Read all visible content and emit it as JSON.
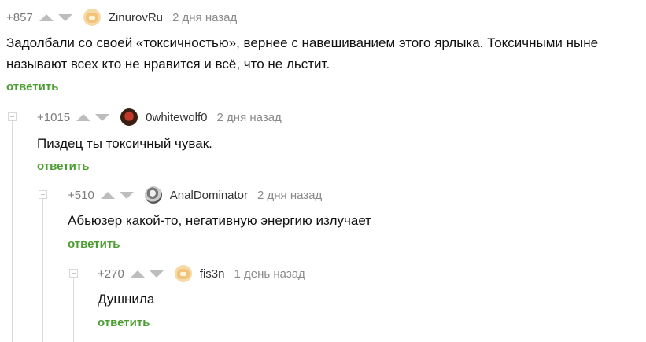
{
  "comments": [
    {
      "rating": "+857",
      "author": "ZinurovRu",
      "time": "2 дня назад",
      "text_lines": [
        "Задолбали со своей «токсичностью», вернее с навешиванием этого ярлыка. Токсичными ныне",
        "называют всех кто не нравится и всё, что не льстит."
      ],
      "reply_label": "ответить",
      "avatar": "default-avatar-icon"
    },
    {
      "rating": "+1015",
      "author": "0whitewolf0",
      "time": "2 дня назад",
      "text_lines": [
        "Пиздец ты токсичный чувак."
      ],
      "reply_label": "ответить",
      "avatar": "wolf-avatar-icon"
    },
    {
      "rating": "+510",
      "author": "AnalDominator",
      "time": "2 дня назад",
      "text_lines": [
        "Абьюзер какой-то, негативную энергию излучает"
      ],
      "reply_label": "ответить",
      "avatar": "sketch-avatar-icon"
    },
    {
      "rating": "+270",
      "author": "fis3n",
      "time": "1 день назад",
      "text_lines": [
        "Душнила"
      ],
      "reply_label": "ответить",
      "avatar": "default-avatar-icon"
    }
  ],
  "colors": {
    "reply": "#4a9d2f",
    "rating": "#7b7b7b",
    "arrow": "#bdbdbd",
    "thread_line": "#dadada"
  }
}
